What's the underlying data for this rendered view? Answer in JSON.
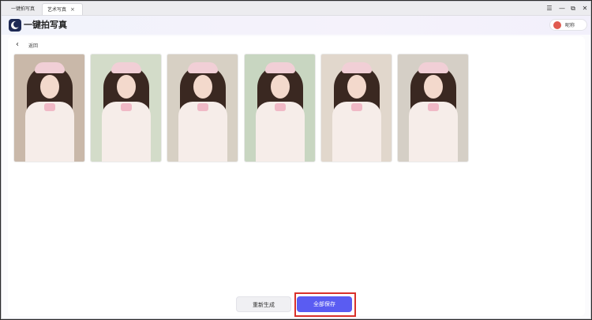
{
  "tabs": [
    {
      "label": "一键拍写真"
    },
    {
      "label": "艺术写真",
      "close": "×"
    }
  ],
  "window_controls": {
    "menu": "☰",
    "minimize": "—",
    "maximize": "⧉",
    "close": "✕"
  },
  "header": {
    "title": "一键拍写真"
  },
  "user": {
    "name": "昵称",
    "avatar_color": "#e05a4f"
  },
  "main": {
    "back_label": "返回"
  },
  "photos": [
    {
      "bg": "#c9b8a9"
    },
    {
      "bg": "#d3dcc9"
    },
    {
      "bg": "#d7d0c4"
    },
    {
      "bg": "#c8d6c1"
    },
    {
      "bg": "#e1d7cc"
    },
    {
      "bg": "#d5cfc6"
    }
  ],
  "buttons": {
    "regenerate": "重新生成",
    "save_all": "全部保存"
  },
  "colors": {
    "accent": "#5a5cf2",
    "highlight": "#d9312b",
    "logo_bg": "#1e2a55"
  },
  "icons": {
    "back": "chevron-left-icon",
    "close": "close-icon"
  }
}
